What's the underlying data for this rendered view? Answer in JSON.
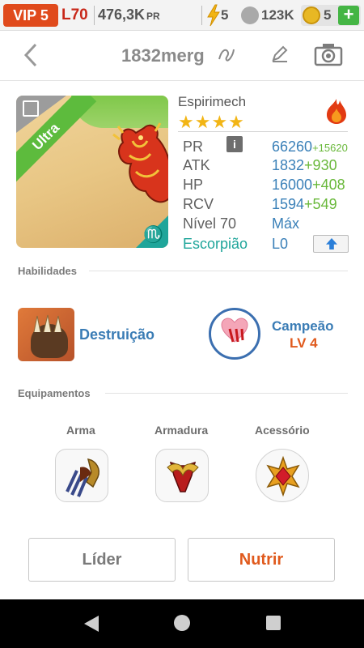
{
  "statusbar": {
    "vip": "VIP 5",
    "level": "L70",
    "pr": "476,3K",
    "pr_unit": "PR",
    "energy": "5",
    "paw": "123K",
    "coins": "5",
    "plus": "+"
  },
  "header": {
    "title": "1832merg"
  },
  "card": {
    "rarity": "Ultra",
    "zodiac_glyph": "♏"
  },
  "monster": {
    "name": "Espirimech",
    "stars": "★★★★",
    "element": "fire",
    "stats": [
      {
        "label": "PR",
        "value": "66260",
        "bonus": "+15620"
      },
      {
        "label": "ATK",
        "value": "1832",
        "bonus": "+930"
      },
      {
        "label": "HP",
        "value": "16000",
        "bonus": "+408"
      },
      {
        "label": "RCV",
        "value": "1594",
        "bonus": "+549"
      },
      {
        "label": "Nível 70",
        "value": "Máx"
      },
      {
        "label": "Escorpião",
        "value": "L0"
      }
    ],
    "info_label": "i"
  },
  "sections": {
    "skills": "Habilidades",
    "equipment": "Equipamentos"
  },
  "skills": [
    {
      "name": "Destruição"
    },
    {
      "name": "Campeão",
      "level": "LV 4"
    }
  ],
  "equipment": [
    {
      "label": "Arma"
    },
    {
      "label": "Armadura"
    },
    {
      "label": "Acessório"
    }
  ],
  "buttons": {
    "leader": "Líder",
    "feed": "Nutrir"
  },
  "colors": {
    "vip_bg": "#e04a1c",
    "stat_value": "#3a80b8",
    "bonus": "#69b83a",
    "feed_text": "#e05a1d",
    "zodiac": "#1fa59a"
  }
}
